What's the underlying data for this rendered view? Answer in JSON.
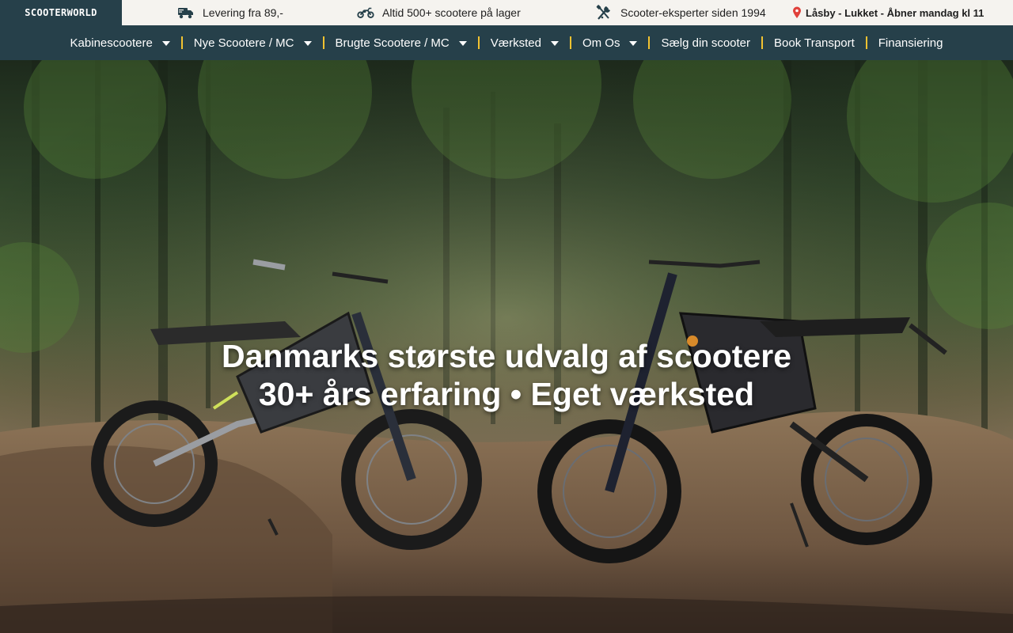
{
  "brand": {
    "logo_text": "SCOOTERWORLD"
  },
  "topbar": {
    "usps": [
      {
        "icon": "truck-icon",
        "text": "Levering fra 89,-"
      },
      {
        "icon": "motorbike-icon",
        "text": "Altid 500+ scootere på lager"
      },
      {
        "icon": "tools-icon",
        "text": "Scooter-eksperter siden 1994"
      }
    ],
    "location": {
      "icon": "map-pin-icon",
      "text": "Låsby - Lukket - Åbner mandag kl 11"
    }
  },
  "nav": {
    "items": [
      {
        "label": "Kabinescootere",
        "has_dropdown": true
      },
      {
        "label": "Nye Scootere / MC",
        "has_dropdown": true
      },
      {
        "label": "Brugte Scootere / MC",
        "has_dropdown": true
      },
      {
        "label": "Værksted",
        "has_dropdown": true
      },
      {
        "label": "Om Os",
        "has_dropdown": true
      },
      {
        "label": "Sælg din scooter",
        "has_dropdown": false
      },
      {
        "label": "Book Transport",
        "has_dropdown": false
      },
      {
        "label": "Finansiering",
        "has_dropdown": false
      }
    ]
  },
  "hero": {
    "line1": "Danmarks største udvalg af scootere",
    "line2": "30+ års erfaring • Eget værksted"
  },
  "colors": {
    "nav_bg": "#26404a",
    "topbar_bg": "#f5f3ef",
    "separator": "#f2c230",
    "text_light": "#ffffff"
  }
}
